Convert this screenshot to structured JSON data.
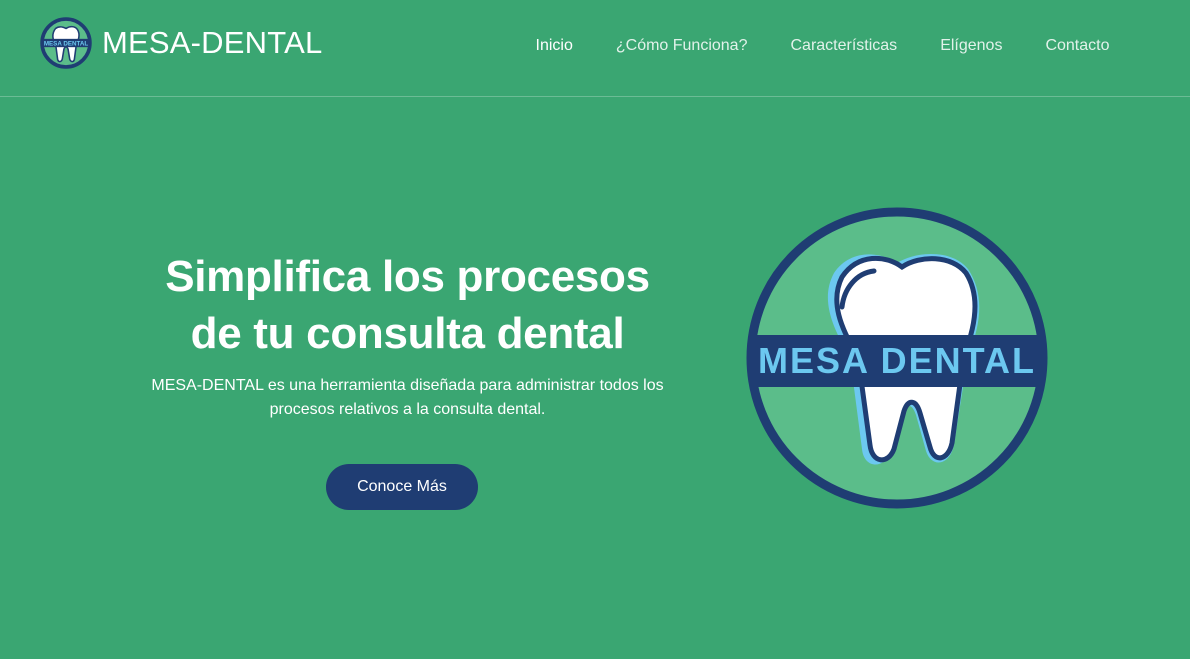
{
  "brand": {
    "name": "MESA-DENTAL",
    "logo_text": "MESA DENTAL"
  },
  "nav": {
    "items": [
      {
        "label": "Inicio",
        "active": true
      },
      {
        "label": "¿Cómo Funciona?",
        "active": false
      },
      {
        "label": "Características",
        "active": false
      },
      {
        "label": "Elígenos",
        "active": false
      },
      {
        "label": "Contacto",
        "active": false
      }
    ]
  },
  "hero": {
    "title_line1": "Simplifica los procesos",
    "title_line2": "de tu consulta dental",
    "subtitle_line1": "MESA-DENTAL es una herramienta diseñada para administrar todos los",
    "subtitle_line2": "procesos relativos a la consulta dental.",
    "cta_label": "Conoce Más",
    "logo_text": "MESA DENTAL"
  },
  "colors": {
    "background": "#3aa672",
    "navy": "#1f3d73",
    "logo_ring_fill": "#5bbd8a",
    "logo_accent": "#6cc8f0"
  }
}
